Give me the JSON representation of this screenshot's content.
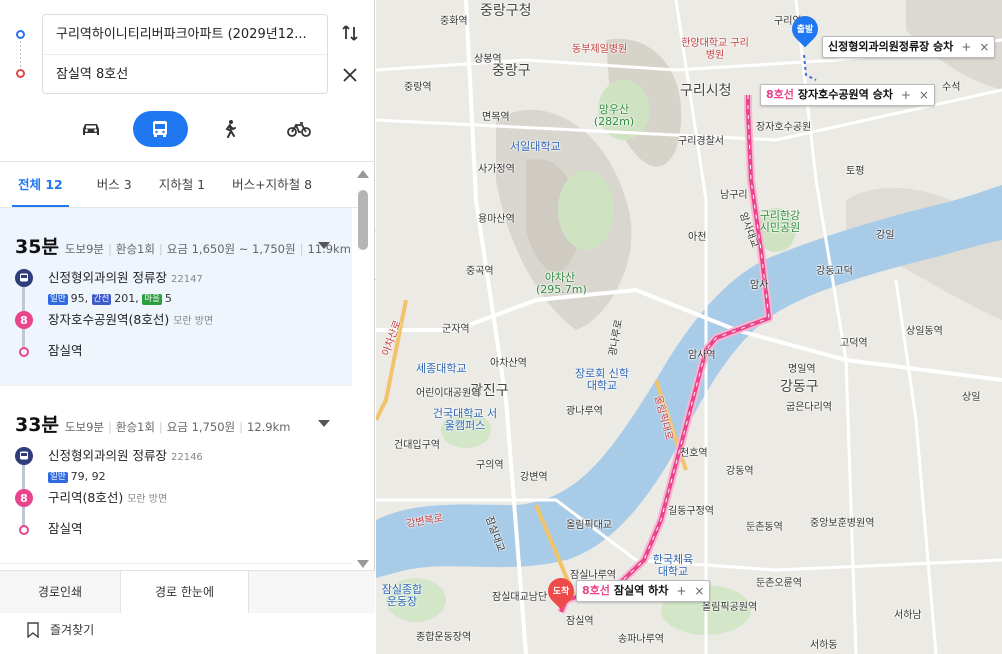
{
  "search": {
    "origin": "구리역하이니티리버파크아파트 (2029년12...",
    "destination": "잠실역 8호선"
  },
  "modes": [
    {
      "name": "car-icon"
    },
    {
      "name": "bus-icon",
      "active": true
    },
    {
      "name": "walk-icon"
    },
    {
      "name": "bike-icon"
    }
  ],
  "tabs": [
    {
      "label": "전체 12",
      "active": true
    },
    {
      "label": "버스 3"
    },
    {
      "label": "지하철 1"
    },
    {
      "label": "버스+지하철 8"
    }
  ],
  "results": [
    {
      "time": "35분",
      "walk": "도보9분",
      "transfer": "환승1회",
      "fare": "요금 1,650원 ~ 1,750원",
      "distance": "11.9km",
      "board_stop": "신정형외과의원 정류장",
      "board_stop_id": "22147",
      "bus_general_tag": "일반",
      "bus_general": "95,",
      "bus_trunk_tag": "간선",
      "bus_trunk": "201,",
      "bus_village_tag": "마을",
      "bus_village": "5",
      "subway_line": "8",
      "subway_station": "장자호수공원역(8호선)",
      "subway_dir": "모란 방면",
      "arrive": "잠실역"
    },
    {
      "time": "33분",
      "walk": "도보9분",
      "transfer": "환승1회",
      "fare": "요금 1,750원",
      "distance": "12.9km",
      "board_stop": "신정형외과의원 정류장",
      "board_stop_id": "22146",
      "bus_general_tag": "일반",
      "bus_general": "79, 92",
      "subway_line": "8",
      "subway_station": "구리역(8호선)",
      "subway_dir": "모란 방면",
      "arrive": "잠실역"
    }
  ],
  "footer": {
    "print": "경로인쇄",
    "overview": "경로 한눈에",
    "favorite": "즐겨찾기"
  },
  "map": {
    "start_badge": "출발",
    "end_badge": "도착",
    "callout_board": {
      "name": "신정형외과의원정류장 승차"
    },
    "callout_transfer": {
      "line": "8호선",
      "name": "장자호수공원역 승차"
    },
    "callout_alight": {
      "line": "8호선",
      "name": "잠실역 하차"
    },
    "districts": [
      "중랑구청",
      "중랑구",
      "구리시청",
      "광진구",
      "강동구"
    ],
    "labels": [
      "중화역",
      "동부제일병원",
      "한양대학교 구리병원",
      "구리역",
      "상봉역",
      "중랑역",
      "망우산 (282m)",
      "면목역",
      "서일대학교",
      "구리경찰서",
      "사가정역",
      "남구리",
      "장자호수공원",
      "용마산역",
      "구리한강 시민공원",
      "아천",
      "아차산 (295.7m)",
      "중곡역",
      "암사",
      "강동고덕",
      "강일",
      "군자역",
      "아차산역",
      "세종대학교",
      "장로회 신학대학교",
      "암사역",
      "고덕역",
      "상일동역",
      "명일역",
      "어린이대공원역",
      "광나루역",
      "건국대학교 서울캠퍼스",
      "굽은다리역",
      "건대입구역",
      "천호역",
      "구의역",
      "강동역",
      "강변역",
      "길동구정역",
      "올림픽대교",
      "둔촌동역",
      "잠실나루역",
      "한국체육 대학교",
      "둔촌오륜역",
      "중앙보훈병원역",
      "잠실대교남단",
      "올림픽공원역",
      "잠실역",
      "송파나루역",
      "종합운동장역",
      "서하남",
      "서하동",
      "토평",
      "수석",
      "상일",
      "잠실종합 운동장",
      "아차산로",
      "올림픽대로",
      "암사대교",
      "강변북로",
      "광나루로",
      "잠실대교"
    ],
    "route_color": "#e8458a",
    "route_glow": "#f7b6d2"
  }
}
